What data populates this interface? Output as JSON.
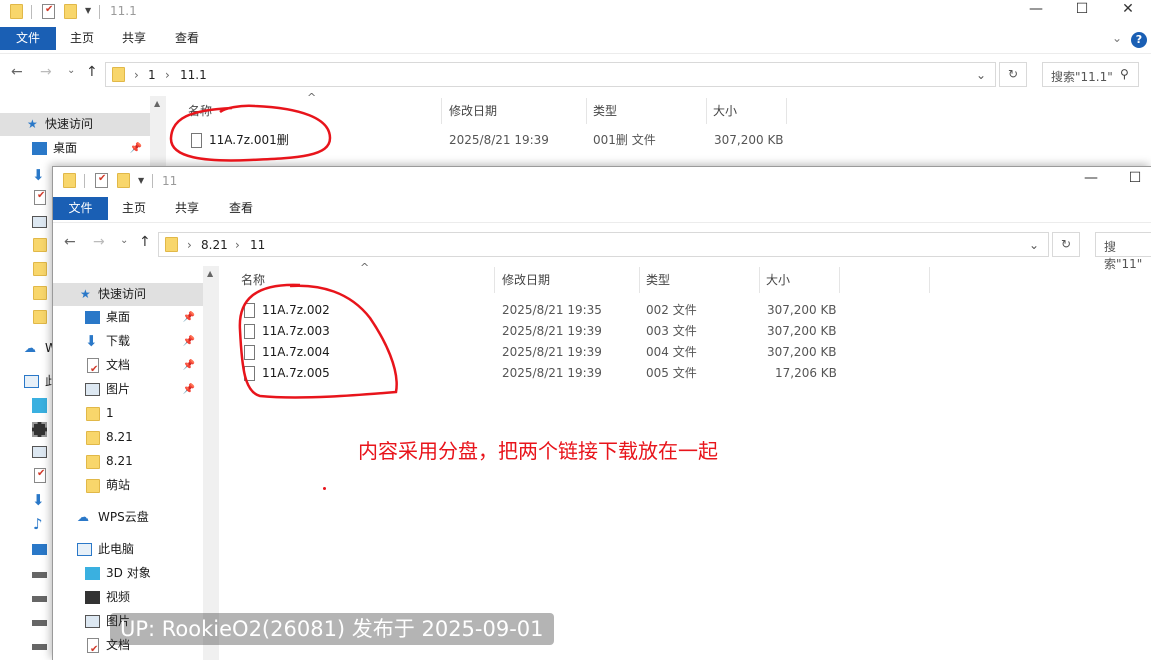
{
  "back_window": {
    "title": "11.1",
    "ribbon_tabs": [
      "文件",
      "主页",
      "共享",
      "查看"
    ],
    "breadcrumb": [
      "1",
      "11.1"
    ],
    "search_placeholder": "搜索\"11.1\"",
    "columns": [
      "名称",
      "修改日期",
      "类型",
      "大小"
    ],
    "files": [
      {
        "name": "11A.7z.001删",
        "date": "2025/8/21 19:39",
        "type": "001删 文件",
        "size": "307,200 KB"
      }
    ],
    "nav": {
      "quick_access": "快速访问",
      "desktop": "桌面",
      "wps": "W",
      "this_pc": "此"
    }
  },
  "front_window": {
    "title": "11",
    "ribbon_tabs": [
      "文件",
      "主页",
      "共享",
      "查看"
    ],
    "breadcrumb": [
      "8.21",
      "11"
    ],
    "search_placeholder": "搜索\"11\"",
    "columns": [
      "名称",
      "修改日期",
      "类型",
      "大小"
    ],
    "files": [
      {
        "name": "11A.7z.002",
        "date": "2025/8/21 19:35",
        "type": "002 文件",
        "size": "307,200 KB"
      },
      {
        "name": "11A.7z.003",
        "date": "2025/8/21 19:39",
        "type": "003 文件",
        "size": "307,200 KB"
      },
      {
        "name": "11A.7z.004",
        "date": "2025/8/21 19:39",
        "type": "004 文件",
        "size": "307,200 KB"
      },
      {
        "name": "11A.7z.005",
        "date": "2025/8/21 19:39",
        "type": "005 文件",
        "size": "17,206 KB"
      }
    ],
    "nav": {
      "quick_access": "快速访问",
      "desktop": "桌面",
      "downloads": "下载",
      "documents": "文档",
      "pictures": "图片",
      "folder_1": "1",
      "folder_821a": "8.21",
      "folder_821b": "8.21",
      "folder_meng": "萌站",
      "wps": "WPS云盘",
      "this_pc": "此电脑",
      "objects3d": "3D 对象",
      "videos": "视频",
      "pictures2": "图片",
      "documents2": "文档"
    }
  },
  "annotation": "内容采用分盘，把两个链接下载放在一起",
  "watermark": "UP: RookieO2(26081) 发布于 2025-09-01",
  "colors": {
    "file_tab": "#1a5fb4",
    "annotation_red": "#e8141b",
    "folder": "#f8d66b"
  }
}
